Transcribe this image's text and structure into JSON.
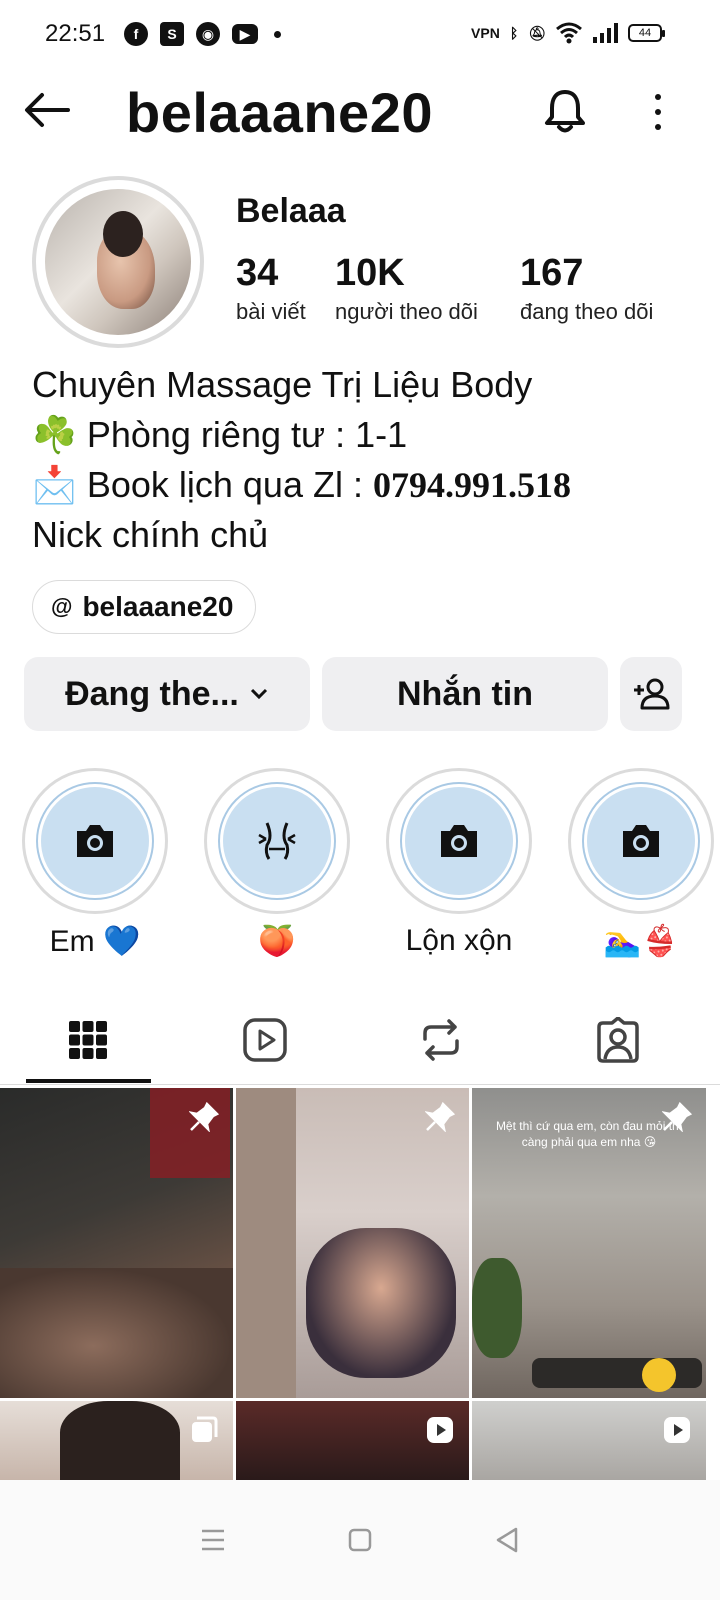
{
  "status_bar": {
    "time": "22:51",
    "battery": "44",
    "vpn_label": "VPN"
  },
  "header": {
    "username": "belaaane20"
  },
  "profile": {
    "display_name": "Belaaa",
    "posts_count": "34",
    "posts_label": "bài viết",
    "followers_count": "10K",
    "followers_label": "người theo dõi",
    "following_count": "167",
    "following_label": "đang theo dõi"
  },
  "bio": {
    "line1": "Chuyên Massage Trị Liệu Body",
    "line2_emoji": "☘️",
    "line2": " Phòng riêng tư : 1-1",
    "line3_emoji": "📩",
    "line3": " Book lịch qua Zl : ",
    "phone": "0794.991.518",
    "line4": "Nick chính chủ"
  },
  "threads_link": {
    "icon": "threads-icon",
    "text": "belaaane20"
  },
  "actions": {
    "following_label": "Đang the...",
    "message_label": "Nhắn tin"
  },
  "highlights": [
    {
      "label": "Em 💙",
      "icon": "camera-icon"
    },
    {
      "label": "🍑",
      "icon": "waist-icon"
    },
    {
      "label": "Lộn xộn",
      "icon": "camera-icon"
    },
    {
      "label": "🏊‍♀️👙",
      "icon": "camera-icon"
    }
  ],
  "tabs": [
    "grid-icon",
    "reels-icon",
    "reposts-icon",
    "tagged-icon"
  ],
  "grid": {
    "tile3_caption": "Mệt thì cứ qua em, còn đau mỏi thì càng phải qua em nha 😘"
  },
  "colors": {
    "button_bg": "#efeff1",
    "highlight_fill": "#c9dff1",
    "text": "#111111"
  }
}
